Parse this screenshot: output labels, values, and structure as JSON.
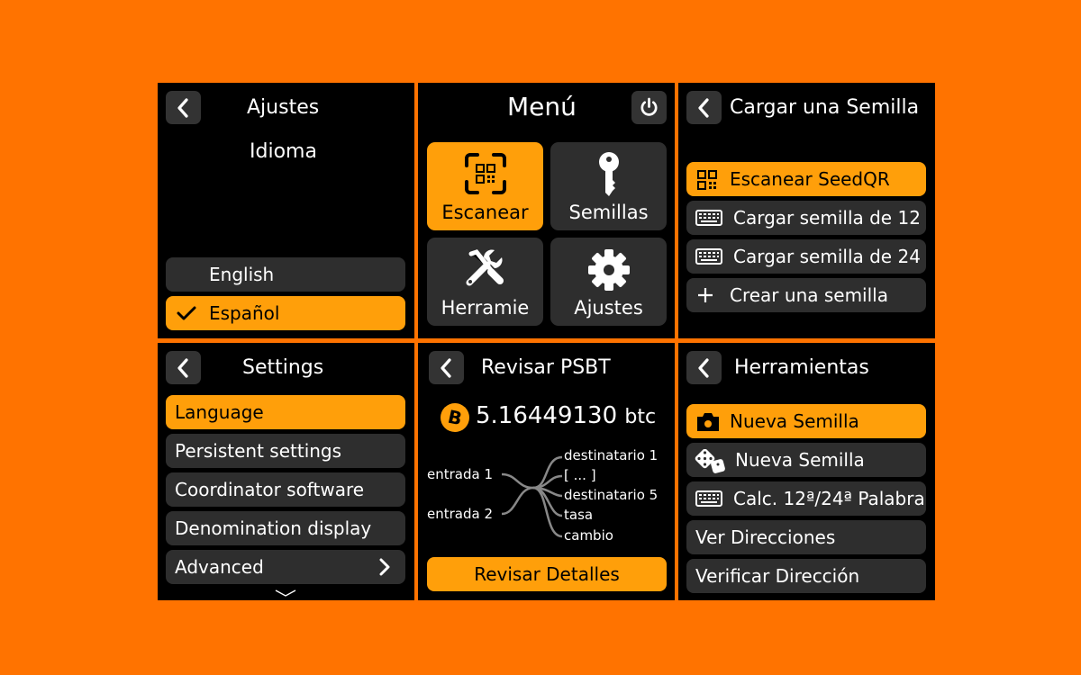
{
  "colors": {
    "background": "#ff7300",
    "accent": "#ff9f0a",
    "panel": "#000000",
    "button": "#2e2e2e"
  },
  "panel_ajustes": {
    "title": "Ajustes",
    "subtitle": "Idioma",
    "back_icon": "chevron-left-icon",
    "options": [
      {
        "label": "English",
        "selected": false
      },
      {
        "label": "Español",
        "selected": true,
        "icon": "check-icon"
      }
    ]
  },
  "panel_menu": {
    "title": "Menú",
    "power_icon": "power-icon",
    "tiles": [
      {
        "label": "Escanear",
        "icon": "qr-scan-icon",
        "selected": true
      },
      {
        "label": "Semillas",
        "icon": "key-icon",
        "selected": false
      },
      {
        "label": "Herramie",
        "icon": "tools-icon",
        "selected": false
      },
      {
        "label": "Ajustes",
        "icon": "gear-icon",
        "selected": false
      }
    ]
  },
  "panel_cargar": {
    "title": "Cargar una Semilla",
    "items": [
      {
        "label": "Escanear SeedQR",
        "icon": "qr-icon",
        "selected": true
      },
      {
        "label": "Cargar semilla de 12",
        "icon": "keyboard-icon",
        "selected": false
      },
      {
        "label": "Cargar semilla de 24",
        "icon": "keyboard-icon",
        "selected": false
      },
      {
        "label": "Crear una semilla",
        "icon": "plus-icon",
        "selected": false
      }
    ]
  },
  "panel_settings": {
    "title": "Settings",
    "items": [
      {
        "label": "Language",
        "selected": true
      },
      {
        "label": "Persistent settings",
        "selected": false
      },
      {
        "label": "Coordinator software",
        "selected": false
      },
      {
        "label": "Denomination display",
        "selected": false
      },
      {
        "label": "Advanced",
        "selected": false,
        "icon": "chevron-right-icon"
      }
    ],
    "scroll_icon": "chevron-down-icon"
  },
  "panel_psbt": {
    "title": "Revisar PSBT",
    "amount": "5.16449130",
    "unit": "btc",
    "coin_icon": "bitcoin-icon",
    "inputs": [
      "entrada 1",
      "entrada 2"
    ],
    "outputs": [
      "destinatario 1",
      "[ ... ]",
      "destinatario 5",
      "tasa",
      "cambio"
    ],
    "button": "Revisar Detalles"
  },
  "panel_herramientas": {
    "title": "Herramientas",
    "items": [
      {
        "label": "Nueva Semilla",
        "icon": "camera-icon",
        "selected": true
      },
      {
        "label": "Nueva Semilla",
        "icon": "dice-icon",
        "selected": false
      },
      {
        "label": "Calc. 12ª/24ª Palabra",
        "icon": "keyboard-icon",
        "selected": false
      },
      {
        "label": "Ver Direcciones",
        "selected": false
      },
      {
        "label": "Verificar Dirección",
        "selected": false
      }
    ]
  }
}
